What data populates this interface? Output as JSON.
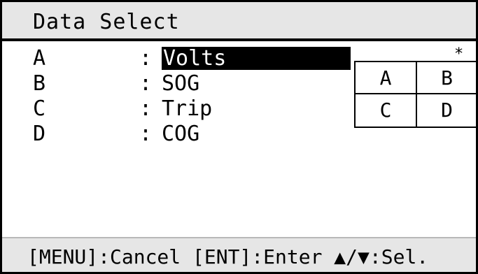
{
  "title": "Data Select",
  "rows": [
    {
      "letter": "A",
      "colon": ":",
      "value": "Volts",
      "selected": true
    },
    {
      "letter": "B",
      "colon": ":",
      "value": "SOG",
      "selected": false
    },
    {
      "letter": "C",
      "colon": ":",
      "value": "Trip",
      "selected": false
    },
    {
      "letter": "D",
      "colon": ":",
      "value": "COG",
      "selected": false
    }
  ],
  "layout_preview": {
    "marker": "*",
    "cells": [
      "A",
      "B",
      "C",
      "D"
    ]
  },
  "footer": {
    "hint": "[MENU]:Cancel [ENT]:Enter ▲/▼:Sel."
  },
  "colors": {
    "background": "#ffffff",
    "bar_background": "#e6e6e6",
    "highlight": "#000000",
    "highlight_text": "#ffffff"
  }
}
